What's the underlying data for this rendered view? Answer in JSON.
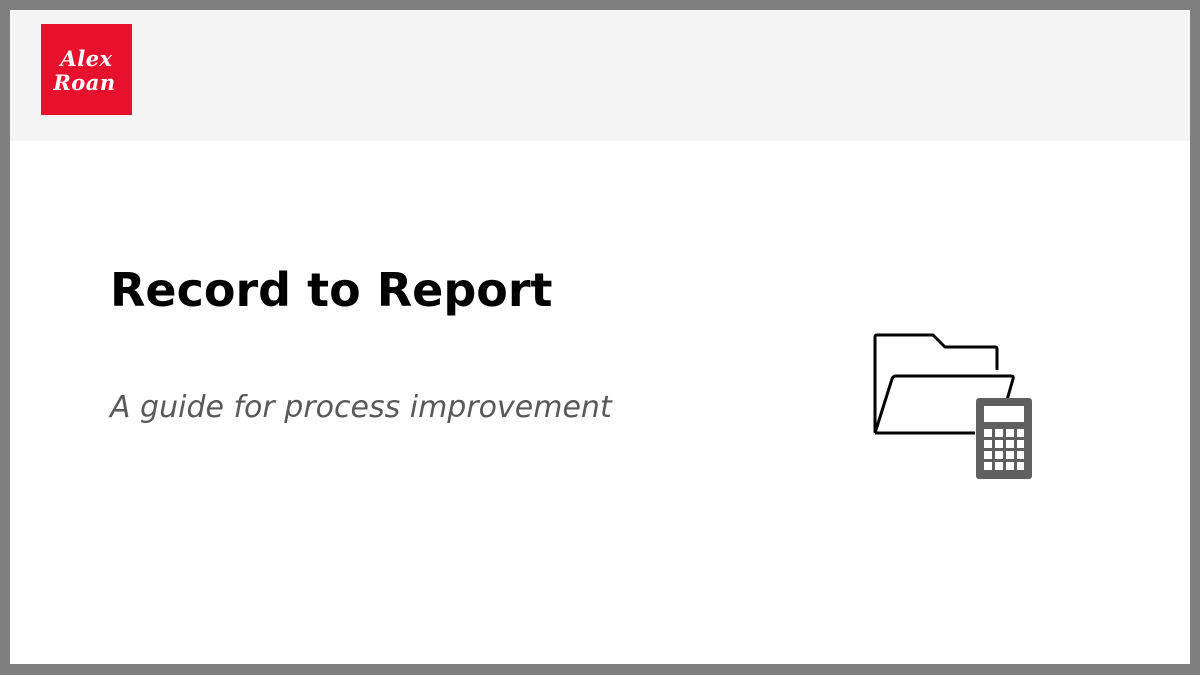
{
  "logo": {
    "line1": "Alex",
    "line2": "Roan",
    "color": "#e8112d"
  },
  "slide": {
    "title": "Record to Report",
    "subtitle": "A guide for process improvement"
  },
  "icons": {
    "folder": "open-folder-icon",
    "calculator": "calculator-icon"
  }
}
